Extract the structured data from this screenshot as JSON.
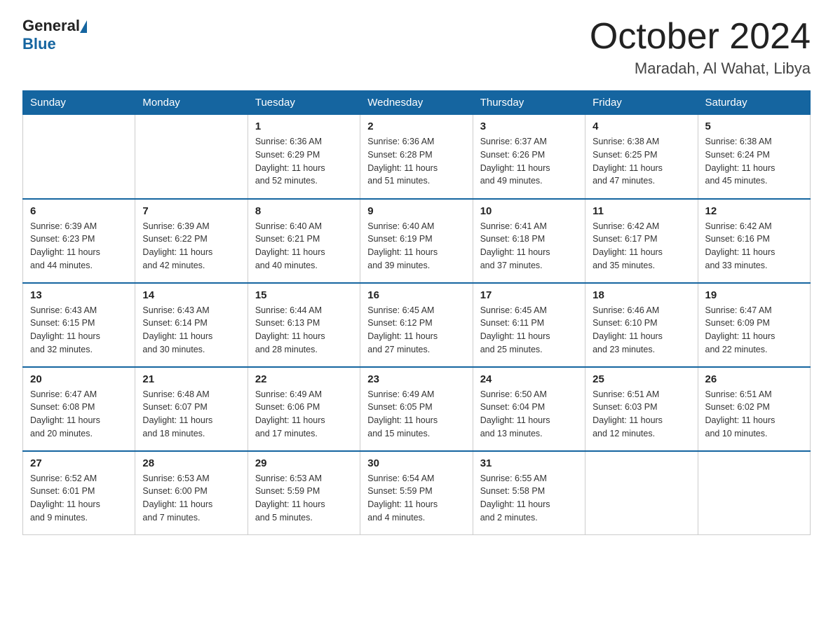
{
  "header": {
    "logo_general": "General",
    "logo_blue": "Blue",
    "month_title": "October 2024",
    "location": "Maradah, Al Wahat, Libya"
  },
  "days_of_week": [
    "Sunday",
    "Monday",
    "Tuesday",
    "Wednesday",
    "Thursday",
    "Friday",
    "Saturday"
  ],
  "weeks": [
    [
      {
        "day": "",
        "info": ""
      },
      {
        "day": "",
        "info": ""
      },
      {
        "day": "1",
        "info": "Sunrise: 6:36 AM\nSunset: 6:29 PM\nDaylight: 11 hours\nand 52 minutes."
      },
      {
        "day": "2",
        "info": "Sunrise: 6:36 AM\nSunset: 6:28 PM\nDaylight: 11 hours\nand 51 minutes."
      },
      {
        "day": "3",
        "info": "Sunrise: 6:37 AM\nSunset: 6:26 PM\nDaylight: 11 hours\nand 49 minutes."
      },
      {
        "day": "4",
        "info": "Sunrise: 6:38 AM\nSunset: 6:25 PM\nDaylight: 11 hours\nand 47 minutes."
      },
      {
        "day": "5",
        "info": "Sunrise: 6:38 AM\nSunset: 6:24 PM\nDaylight: 11 hours\nand 45 minutes."
      }
    ],
    [
      {
        "day": "6",
        "info": "Sunrise: 6:39 AM\nSunset: 6:23 PM\nDaylight: 11 hours\nand 44 minutes."
      },
      {
        "day": "7",
        "info": "Sunrise: 6:39 AM\nSunset: 6:22 PM\nDaylight: 11 hours\nand 42 minutes."
      },
      {
        "day": "8",
        "info": "Sunrise: 6:40 AM\nSunset: 6:21 PM\nDaylight: 11 hours\nand 40 minutes."
      },
      {
        "day": "9",
        "info": "Sunrise: 6:40 AM\nSunset: 6:19 PM\nDaylight: 11 hours\nand 39 minutes."
      },
      {
        "day": "10",
        "info": "Sunrise: 6:41 AM\nSunset: 6:18 PM\nDaylight: 11 hours\nand 37 minutes."
      },
      {
        "day": "11",
        "info": "Sunrise: 6:42 AM\nSunset: 6:17 PM\nDaylight: 11 hours\nand 35 minutes."
      },
      {
        "day": "12",
        "info": "Sunrise: 6:42 AM\nSunset: 6:16 PM\nDaylight: 11 hours\nand 33 minutes."
      }
    ],
    [
      {
        "day": "13",
        "info": "Sunrise: 6:43 AM\nSunset: 6:15 PM\nDaylight: 11 hours\nand 32 minutes."
      },
      {
        "day": "14",
        "info": "Sunrise: 6:43 AM\nSunset: 6:14 PM\nDaylight: 11 hours\nand 30 minutes."
      },
      {
        "day": "15",
        "info": "Sunrise: 6:44 AM\nSunset: 6:13 PM\nDaylight: 11 hours\nand 28 minutes."
      },
      {
        "day": "16",
        "info": "Sunrise: 6:45 AM\nSunset: 6:12 PM\nDaylight: 11 hours\nand 27 minutes."
      },
      {
        "day": "17",
        "info": "Sunrise: 6:45 AM\nSunset: 6:11 PM\nDaylight: 11 hours\nand 25 minutes."
      },
      {
        "day": "18",
        "info": "Sunrise: 6:46 AM\nSunset: 6:10 PM\nDaylight: 11 hours\nand 23 minutes."
      },
      {
        "day": "19",
        "info": "Sunrise: 6:47 AM\nSunset: 6:09 PM\nDaylight: 11 hours\nand 22 minutes."
      }
    ],
    [
      {
        "day": "20",
        "info": "Sunrise: 6:47 AM\nSunset: 6:08 PM\nDaylight: 11 hours\nand 20 minutes."
      },
      {
        "day": "21",
        "info": "Sunrise: 6:48 AM\nSunset: 6:07 PM\nDaylight: 11 hours\nand 18 minutes."
      },
      {
        "day": "22",
        "info": "Sunrise: 6:49 AM\nSunset: 6:06 PM\nDaylight: 11 hours\nand 17 minutes."
      },
      {
        "day": "23",
        "info": "Sunrise: 6:49 AM\nSunset: 6:05 PM\nDaylight: 11 hours\nand 15 minutes."
      },
      {
        "day": "24",
        "info": "Sunrise: 6:50 AM\nSunset: 6:04 PM\nDaylight: 11 hours\nand 13 minutes."
      },
      {
        "day": "25",
        "info": "Sunrise: 6:51 AM\nSunset: 6:03 PM\nDaylight: 11 hours\nand 12 minutes."
      },
      {
        "day": "26",
        "info": "Sunrise: 6:51 AM\nSunset: 6:02 PM\nDaylight: 11 hours\nand 10 minutes."
      }
    ],
    [
      {
        "day": "27",
        "info": "Sunrise: 6:52 AM\nSunset: 6:01 PM\nDaylight: 11 hours\nand 9 minutes."
      },
      {
        "day": "28",
        "info": "Sunrise: 6:53 AM\nSunset: 6:00 PM\nDaylight: 11 hours\nand 7 minutes."
      },
      {
        "day": "29",
        "info": "Sunrise: 6:53 AM\nSunset: 5:59 PM\nDaylight: 11 hours\nand 5 minutes."
      },
      {
        "day": "30",
        "info": "Sunrise: 6:54 AM\nSunset: 5:59 PM\nDaylight: 11 hours\nand 4 minutes."
      },
      {
        "day": "31",
        "info": "Sunrise: 6:55 AM\nSunset: 5:58 PM\nDaylight: 11 hours\nand 2 minutes."
      },
      {
        "day": "",
        "info": ""
      },
      {
        "day": "",
        "info": ""
      }
    ]
  ]
}
